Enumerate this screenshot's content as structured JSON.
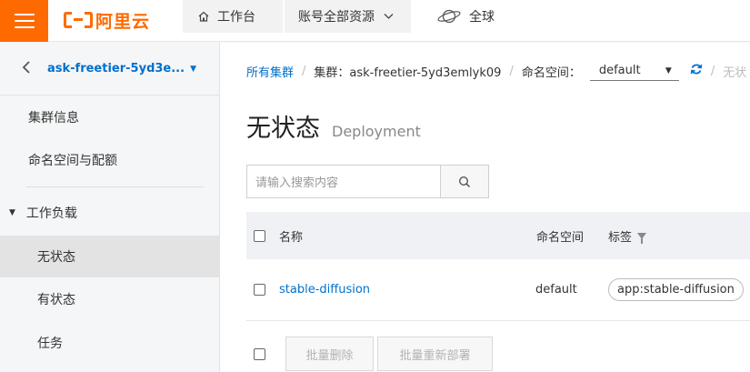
{
  "topbar": {
    "logo_text": "阿里云",
    "workbench_label": "工作台",
    "resources_label": "账号全部资源",
    "region_label": "全球",
    "icons": {
      "menu": "hamburger-menu-icon",
      "home": "home-icon",
      "chevron": "chevron-down-icon",
      "globe": "planet-globe-icon"
    }
  },
  "sidebar": {
    "cluster_name": "ask-freetier-5yd3e...",
    "items": [
      {
        "label": "集群信息"
      },
      {
        "label": "命名空间与配额"
      },
      {
        "label": "工作负载"
      },
      {
        "label": "无状态",
        "active": true
      },
      {
        "label": "有状态"
      },
      {
        "label": "任务"
      }
    ]
  },
  "breadcrumb": {
    "all_clusters": "所有集群",
    "cluster": "集群：ask-freetier-5yd3emlyk09",
    "namespace_label": "命名空间：",
    "namespace_value": "default",
    "trailing": "无状"
  },
  "page": {
    "title": "无状态",
    "subtitle": "Deployment"
  },
  "search": {
    "placeholder": "请输入搜索内容"
  },
  "table": {
    "columns": [
      "名称",
      "命名空间",
      "标签"
    ],
    "rows": [
      {
        "name": "stable-diffusion",
        "namespace": "default",
        "tag": "app:stable-diffusion"
      }
    ]
  },
  "actions": {
    "batch_delete": "批量删除",
    "batch_redeploy": "批量重新部署"
  },
  "colors": {
    "brand": "#ff6a00",
    "link": "#0070cc"
  }
}
